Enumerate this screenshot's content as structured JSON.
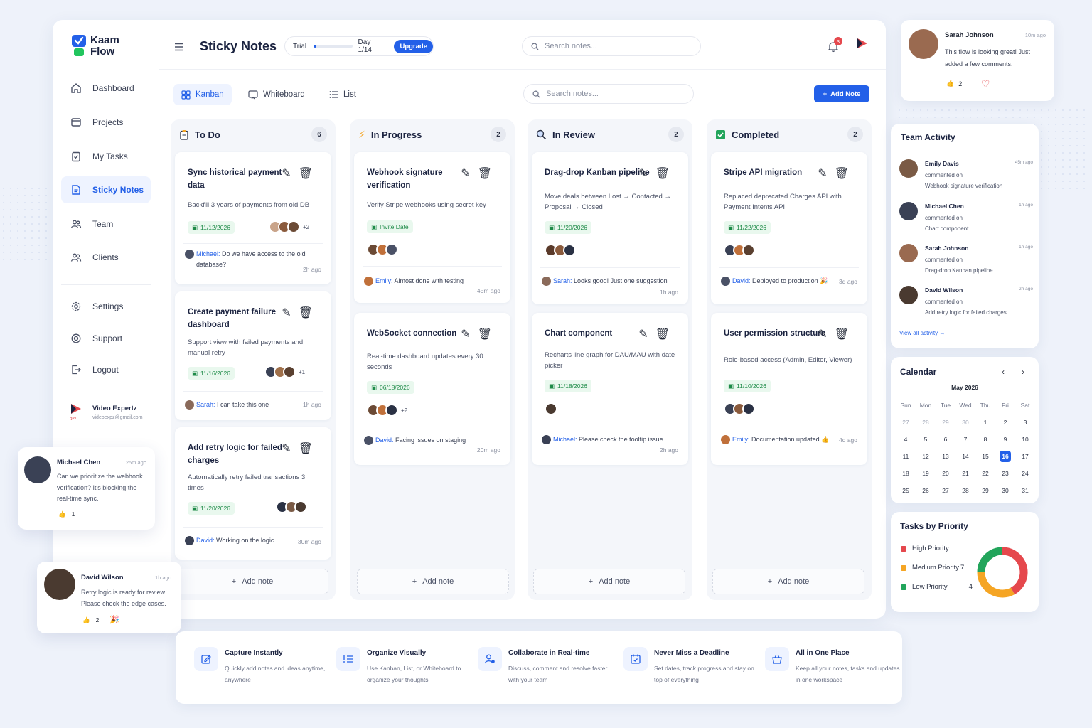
{
  "brand": {
    "line1": "Kaam",
    "line2": "Flow",
    "accent": "#2360e8"
  },
  "sidebar": {
    "items": [
      {
        "label": "Dashboard",
        "icon": "home-icon"
      },
      {
        "label": "Projects",
        "icon": "folder-icon"
      },
      {
        "label": "My Tasks",
        "icon": "clipboard-check-icon"
      },
      {
        "label": "Sticky Notes",
        "icon": "note-icon",
        "active": true
      },
      {
        "label": "Team",
        "icon": "team-icon"
      },
      {
        "label": "Clients",
        "icon": "clients-icon"
      }
    ],
    "secondary": [
      {
        "label": "Settings",
        "icon": "gear-icon"
      },
      {
        "label": "Support",
        "icon": "support-icon"
      },
      {
        "label": "Logout",
        "icon": "logout-icon"
      }
    ],
    "account": {
      "name": "Video Expertz",
      "email": "videoexpz@gmail.com"
    }
  },
  "header": {
    "title": "Sticky Notes",
    "trial_label": "Trial",
    "trial_day": "Day 1/14",
    "trial_progress": 0.07,
    "upgrade_label": "Upgrade",
    "search_placeholder": "Search notes...",
    "notification_count": "3"
  },
  "views": {
    "tabs": [
      {
        "label": "Kanban",
        "active": true
      },
      {
        "label": "Whiteboard"
      },
      {
        "label": "List"
      }
    ],
    "search_placeholder": "Search notes...",
    "add_note_label": "Add Note"
  },
  "columns": [
    {
      "title": "To Do",
      "count": "6",
      "notes": [
        {
          "title": "Sync historical payment data",
          "desc": "Backfill 3 years of payments from old DB",
          "date": "11/12/2026",
          "more": "+2",
          "comment_who": "Michael:",
          "comment_text": "Do we have access to the old database?",
          "time": "2h ago"
        },
        {
          "title": "Create payment failure dashboard",
          "desc": "Support view with failed payments and manual retry",
          "date": "11/16/2026",
          "more": "+1",
          "comment_who": "Sarah:",
          "comment_text": "I can take this one",
          "time": "1h ago"
        },
        {
          "title": "Add retry logic for failed charges",
          "desc": "Automatically retry failed transactions 3 times",
          "date": "11/20/2026",
          "more": "",
          "comment_who": "David:",
          "comment_text": "Working on the logic",
          "time": "30m ago"
        }
      ],
      "add_label": "Add note"
    },
    {
      "title": "In Progress",
      "count": "2",
      "notes": [
        {
          "title": "Webhook signature verification",
          "desc": "Verify Stripe webhooks using secret key",
          "date": "Invite Date",
          "more": "",
          "comment_who": "Emily:",
          "comment_text": "Almost done with testing",
          "time": "45m ago"
        },
        {
          "title": "WebSocket connection",
          "desc": "Real-time dashboard updates every 30 seconds",
          "date": "06/18/2026",
          "more": "+2",
          "comment_who": "David:",
          "comment_text": "Facing issues on staging",
          "time": "20m ago"
        }
      ],
      "add_label": "Add note"
    },
    {
      "title": "In Review",
      "count": "2",
      "notes": [
        {
          "title": "Drag-drop Kanban pipeline",
          "desc": "Move deals between Lost → Contacted → Proposal → Closed",
          "date": "11/20/2026",
          "more": "",
          "comment_who": "Sarah:",
          "comment_text": "Looks good! Just one suggestion",
          "time": "1h ago"
        },
        {
          "title": "Chart component",
          "desc": "Recharts line graph for DAU/MAU with date picker",
          "date": "11/18/2026",
          "more": "",
          "comment_who": "Michael:",
          "comment_text": "Please check the tooltip issue",
          "time": "2h ago"
        }
      ],
      "add_label": "Add note"
    },
    {
      "title": "Completed",
      "count": "2",
      "notes": [
        {
          "title": "Stripe API migration",
          "desc": "Replaced deprecated Charges API with Payment Intents API",
          "date": "11/22/2026",
          "more": "",
          "comment_who": "David:",
          "comment_text": "Deployed to production 🎉",
          "time": "3d ago"
        },
        {
          "title": "User permission structure",
          "desc": "Role-based access (Admin, Editor, Viewer)",
          "date": "11/10/2026",
          "more": "",
          "comment_who": "Emily:",
          "comment_text": "Documentation updated 👍",
          "time": "4d ago"
        }
      ],
      "add_label": "Add note"
    }
  ],
  "top_comment": {
    "name": "Sarah Johnson",
    "time": "10m ago",
    "text": "This flow is looking great! Just added a few comments.",
    "likes": "2"
  },
  "team_activity": {
    "title": "Team Activity",
    "items": [
      {
        "name": "Emily Davis",
        "time": "45m ago",
        "action": "commented on",
        "target": "Webhook signature verification"
      },
      {
        "name": "Michael Chen",
        "time": "1h ago",
        "action": "commented on",
        "target": "Chart component"
      },
      {
        "name": "Sarah Johnson",
        "time": "1h ago",
        "action": "commented on",
        "target": "Drag-drop Kanban pipeline"
      },
      {
        "name": "David Wilson",
        "time": "2h ago",
        "action": "commented on",
        "target": "Add retry logic for failed charges"
      }
    ],
    "view_all": "View all activity"
  },
  "calendar": {
    "title": "Calendar",
    "month": "May 2026",
    "weekdays": [
      "Sun",
      "Mon",
      "Tue",
      "Wed",
      "Thu",
      "Fri",
      "Sat"
    ],
    "weeks": [
      [
        "27",
        "28",
        "29",
        "30",
        "1",
        "2",
        "3"
      ],
      [
        "4",
        "5",
        "6",
        "7",
        "8",
        "9",
        "10"
      ],
      [
        "11",
        "12",
        "13",
        "14",
        "15",
        "16",
        "17"
      ],
      [
        "18",
        "19",
        "20",
        "21",
        "22",
        "23",
        "24"
      ],
      [
        "25",
        "26",
        "27",
        "28",
        "29",
        "30",
        "31"
      ]
    ],
    "today": "16"
  },
  "priority": {
    "title": "Tasks by Priority",
    "items": [
      {
        "label": "High Priority",
        "value": "",
        "color": "#e5484d"
      },
      {
        "label": "Medium Priority",
        "value": "7",
        "color": "#f5a524"
      },
      {
        "label": "Low Priority",
        "value": "4",
        "color": "#22a55b"
      }
    ],
    "donut_fractions": [
      0.42,
      0.33,
      0.25
    ]
  },
  "float_comments": [
    {
      "name": "Michael Chen",
      "time": "25m ago",
      "text": "Can we prioritize the webhook verification? It's blocking the real-time sync.",
      "likes": "1"
    },
    {
      "name": "David Wilson",
      "time": "1h ago",
      "text": "Retry logic is ready for review. Please check the edge cases.",
      "likes": "2"
    }
  ],
  "features": [
    {
      "title": "Capture Instantly",
      "desc": "Quickly add notes and ideas anytime, anywhere",
      "icon": "edit-note-icon"
    },
    {
      "title": "Organize Visually",
      "desc": "Use Kanban, List, or Whiteboard to organize your thoughts",
      "icon": "list-organize-icon"
    },
    {
      "title": "Collaborate in Real-time",
      "desc": "Discuss, comment and resolve faster with your team",
      "icon": "collaborate-icon"
    },
    {
      "title": "Never Miss a Deadline",
      "desc": "Set dates, track progress and stay on top of everything",
      "icon": "calendar-check-icon"
    },
    {
      "title": "All in One Place",
      "desc": "Keep all your notes, tasks and updates in one workspace",
      "icon": "basket-icon"
    }
  ]
}
